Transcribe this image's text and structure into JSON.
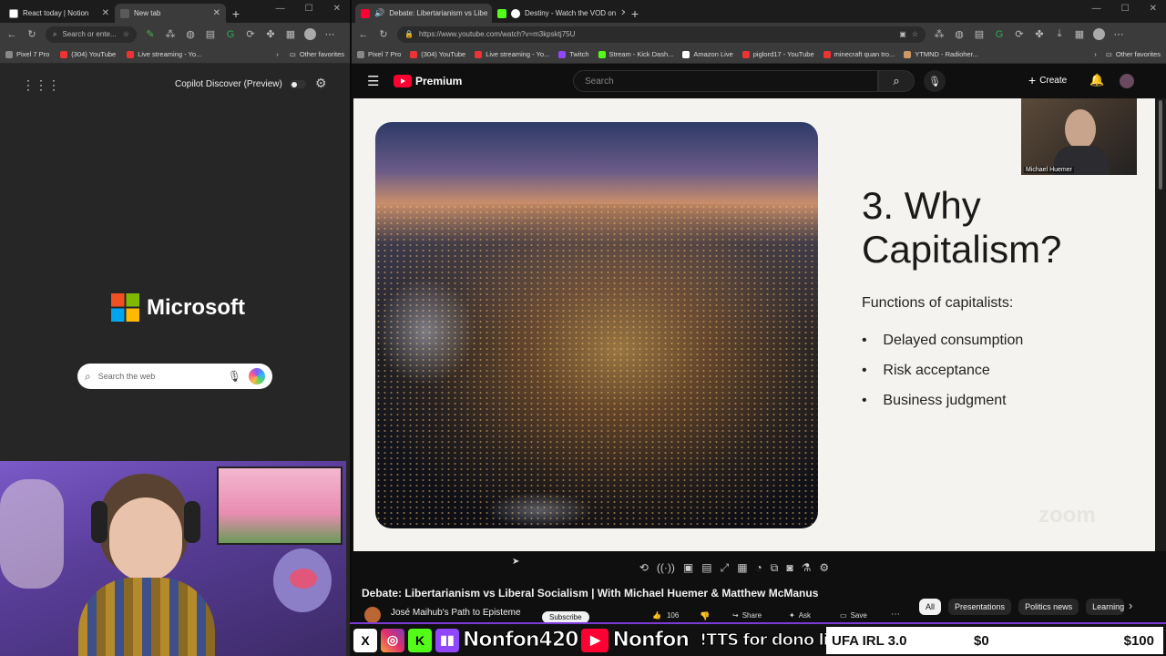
{
  "left_browser": {
    "tabs": [
      {
        "label": "React today | Notion",
        "active": false
      },
      {
        "label": "New tab",
        "active": true
      }
    ],
    "address_placeholder": "Search or ente...",
    "favorites": [
      "Pixel 7 Pro",
      "(304) YouTube",
      "Live streaming - Yo..."
    ],
    "other_favorites": "Other favorites",
    "copilot_discover_label": "Copilot Discover (Preview)",
    "microsoft_logo_text": "Microsoft",
    "search_placeholder": "Search the web"
  },
  "right_browser": {
    "tabs": [
      {
        "label": "Debate: Libertarianism vs Libe",
        "active": true
      },
      {
        "label": "Destiny - Watch the VOD on",
        "active": false
      }
    ],
    "url": "https://www.youtube.com/watch?v=m3kpsktj75U",
    "favorites": [
      "Pixel 7 Pro",
      "(304) YouTube",
      "Live streaming - Yo...",
      "Twitch",
      "Stream - Kick Dash...",
      "Amazon Live",
      "piglord17 - YouTube",
      "minecraft quan tro...",
      "YTMND - Radioher..."
    ],
    "other_favorites": "Other favorites"
  },
  "youtube": {
    "logo_text": "Premium",
    "search_placeholder": "Search",
    "create_label": "Create",
    "slide": {
      "title_line1": "3. Why",
      "title_line2": "Capitalism?",
      "subtitle": "Functions of capitalists:",
      "bullets": [
        "Delayed consumption",
        "Risk acceptance",
        "Business judgment"
      ]
    },
    "speaker_name": "Michael Huemer",
    "zoom_watermark": "zoom",
    "video_title": "Debate: Libertarianism vs Liberal Socialism | With Michael Huemer & Matthew McManus",
    "channel_name": "José Maihub's Path to Episteme",
    "subscribe_label": "Subscribe",
    "likes_count": "106",
    "share_label": "Share",
    "ask_label": "Ask",
    "save_label": "Save",
    "chips": [
      "All",
      "Presentations",
      "Politics news",
      "Learning"
    ]
  },
  "stream_overlay": {
    "handle_1": "Nonfon420",
    "handle_2": "Nonfon",
    "tts_text": "!TTS for dono link",
    "goal_label": "UFA IRL 3.0",
    "goal_current": "$0",
    "goal_target": "$100"
  },
  "colors": {
    "youtube_red": "#ff0033",
    "overlay_purple": "#7c3bd6",
    "copilot_gradient": "#7b5cff"
  }
}
